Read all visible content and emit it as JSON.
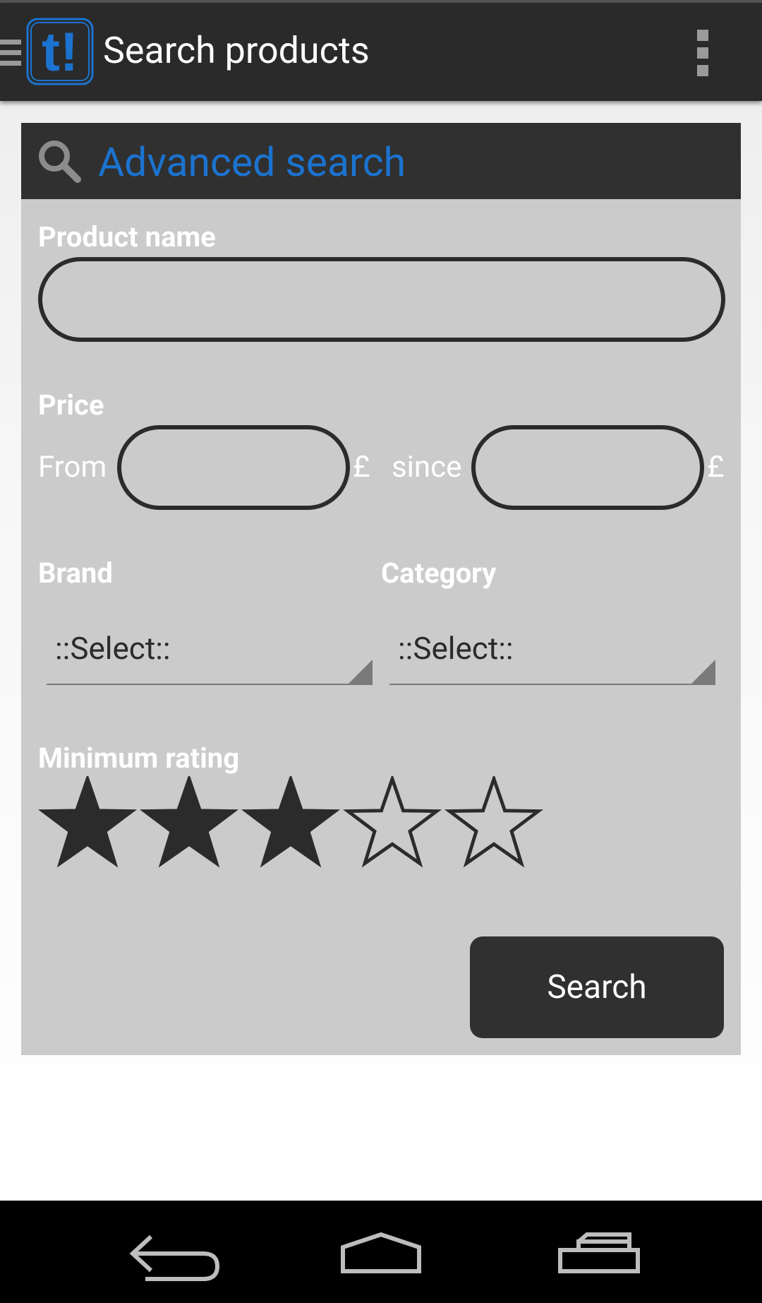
{
  "app_bar": {
    "title": "Search products",
    "logo_text": "t!",
    "left_icon": "drawer-icon",
    "right_icon": "overflow-menu-icon"
  },
  "panel": {
    "title": "Advanced search",
    "icon": "search-icon",
    "product_name": {
      "label": "Product name",
      "value": "",
      "placeholder": ""
    },
    "price": {
      "label": "Price",
      "from_label": "From",
      "from_value": "",
      "from_currency": "£",
      "since_label": "since",
      "since_value": "",
      "since_currency": "£"
    },
    "brand": {
      "label": "Brand",
      "selected": "::Select::"
    },
    "category": {
      "label": "Category",
      "selected": "::Select::"
    },
    "rating": {
      "label": "Minimum rating",
      "value": 3,
      "max": 5
    },
    "search_button": "Search"
  },
  "nav_bar": {
    "icons": [
      "back-icon",
      "home-icon",
      "recent-apps-icon"
    ]
  },
  "colors": {
    "accent": "#1b73d0",
    "action_bar": "#2a2a2a",
    "panel_bg": "#cbcbcb",
    "panel_header": "#303030",
    "dark": "#2b2b2b"
  }
}
